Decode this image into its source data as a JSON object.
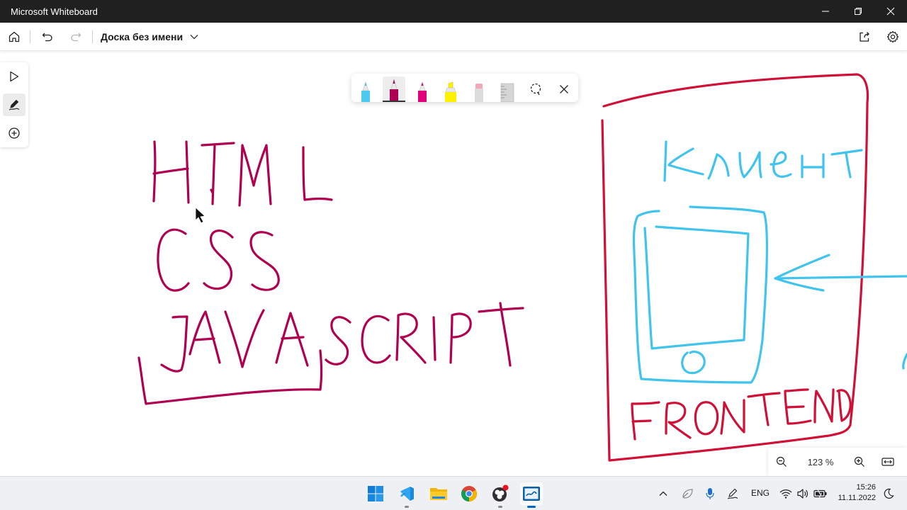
{
  "window": {
    "title": "Microsoft Whiteboard"
  },
  "toolbar": {
    "board_title": "Доска без имени"
  },
  "side_tools": [
    "select-tool",
    "inking-tool",
    "add-tool"
  ],
  "ink_palette": {
    "pens": [
      {
        "name": "cyan-pen",
        "color": "#4cc9f0",
        "selected": false
      },
      {
        "name": "magenta-pen",
        "color": "#b00053",
        "selected": true
      },
      {
        "name": "pink-pen",
        "color": "#e0007a",
        "selected": false
      },
      {
        "name": "highlighter",
        "color": "#fff200",
        "selected": false
      },
      {
        "name": "eraser",
        "color": "#f4a7b9",
        "selected": false
      },
      {
        "name": "ruler",
        "color": "#c8c8c8",
        "selected": false
      }
    ]
  },
  "canvas": {
    "ink_colors": {
      "crimson": "#b0004f",
      "red": "#d01037",
      "cyan": "#40c4ee"
    },
    "handwriting": {
      "html": "HTML",
      "css": "CSS",
      "javascript": "JAVASCRIPT",
      "client": "клиент",
      "front_end": "FRONT END"
    }
  },
  "zoom": {
    "value": "123 %"
  },
  "taskbar": {
    "apps": [
      "windows-start",
      "vscode",
      "file-explorer",
      "chrome",
      "obs-studio",
      "whiteboard"
    ],
    "language": "ENG",
    "time": "15:26",
    "date": "11.11.2022"
  }
}
